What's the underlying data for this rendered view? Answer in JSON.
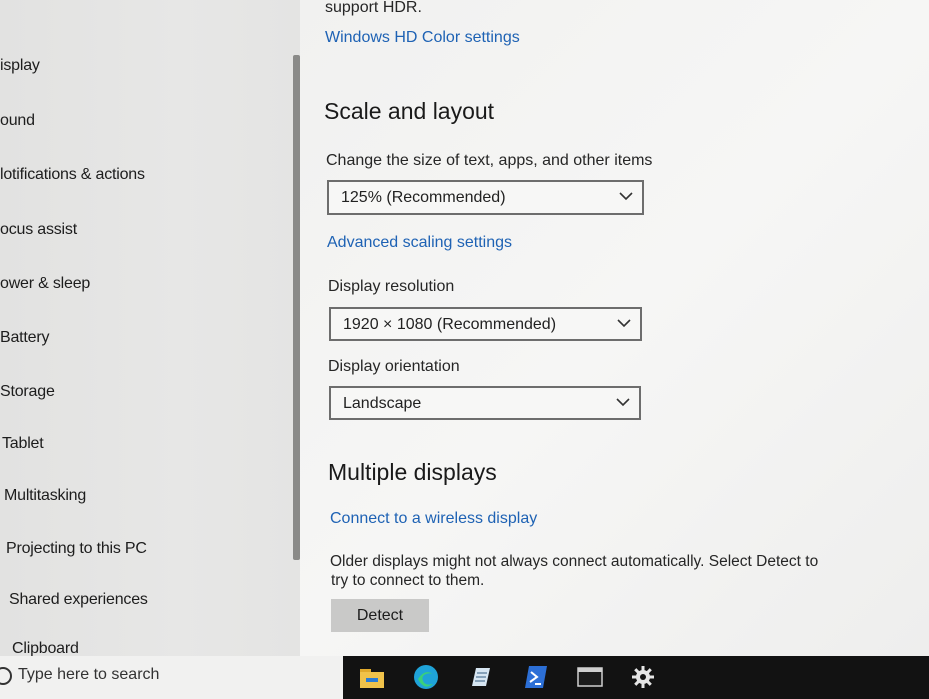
{
  "sidebar": {
    "items": [
      {
        "label": "isplay"
      },
      {
        "label": "ound"
      },
      {
        "label": "lotifications & actions"
      },
      {
        "label": "ocus assist"
      },
      {
        "label": "ower & sleep"
      },
      {
        "label": "Battery"
      },
      {
        "label": "Storage"
      },
      {
        "label": "Tablet"
      },
      {
        "label": "Multitasking"
      },
      {
        "label": "Projecting to this PC"
      },
      {
        "label": "Shared experiences"
      },
      {
        "label": "Clipboard"
      }
    ]
  },
  "main": {
    "hdr_note": "support HDR.",
    "hdr_link": "Windows HD Color settings",
    "scale_heading": "Scale and layout",
    "scale_label": "Change the size of text, apps, and other items",
    "scale_value": "125% (Recommended)",
    "advanced_scaling_link": "Advanced scaling settings",
    "resolution_label": "Display resolution",
    "resolution_value": "1920 × 1080 (Recommended)",
    "orientation_label": "Display orientation",
    "orientation_value": "Landscape",
    "multiple_heading": "Multiple displays",
    "wireless_link": "Connect to a wireless display",
    "older_note_line1": "Older displays might not always connect automatically. Select Detect to",
    "older_note_line2": "try to connect to them.",
    "detect_button": "Detect"
  },
  "taskbar": {
    "search_placeholder": "Type here to search",
    "icons": [
      "file-explorer-icon",
      "edge-icon",
      "notepad-icon",
      "powershell-icon",
      "terminal-icon",
      "settings-gear-icon"
    ]
  },
  "colors": {
    "link": "#1e62b4",
    "taskbar": "#121212",
    "explorer": "#f0c24a",
    "edge": "#1fa3d8",
    "powershell": "#2c6fd6"
  }
}
